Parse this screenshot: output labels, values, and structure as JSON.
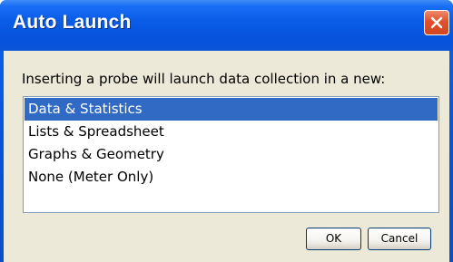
{
  "dialog": {
    "title": "Auto Launch",
    "prompt": "Inserting a probe will launch data collection in a new:",
    "options": [
      "Data & Statistics",
      "Lists & Spreadsheet",
      "Graphs & Geometry",
      "None (Meter Only)"
    ],
    "selected": "Data & Statistics",
    "ok_label": "OK",
    "cancel_label": "Cancel"
  },
  "icons": {
    "close": "close-icon"
  },
  "colors": {
    "titlebar": "#0a5ce8",
    "selection": "#316ac5",
    "close_button": "#e0502b",
    "dialog_background": "#ece9d8"
  }
}
